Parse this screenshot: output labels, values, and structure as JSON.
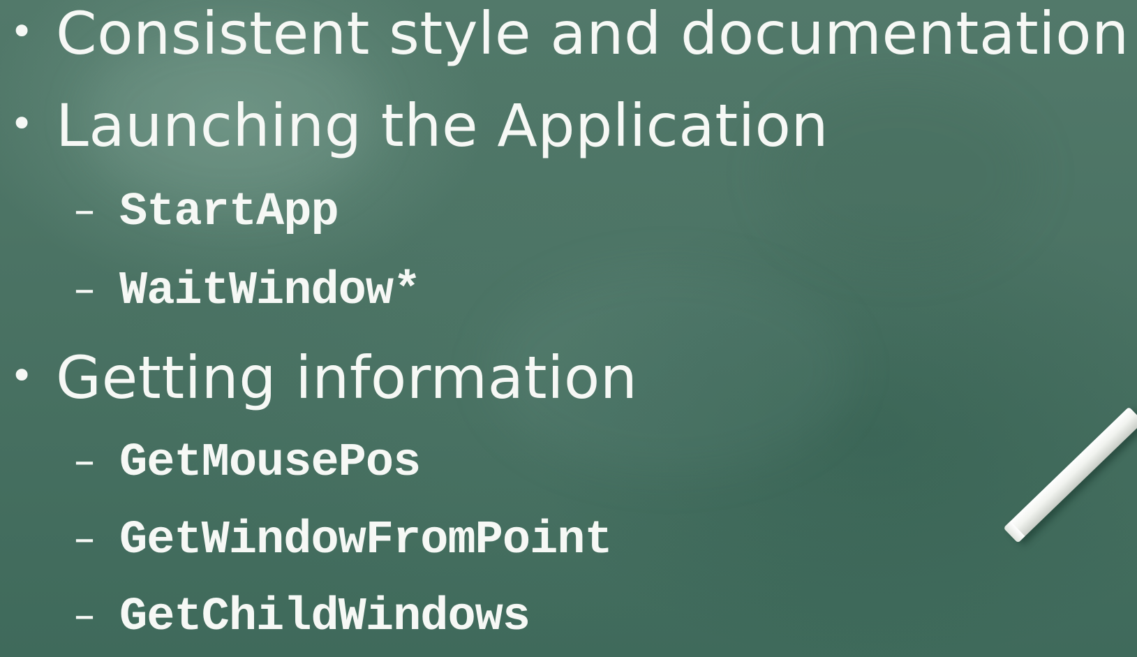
{
  "slide": {
    "bullet_glyph": "•",
    "dash_glyph": "–",
    "items": [
      {
        "level": 1,
        "text": "Consistent style and documentation"
      },
      {
        "level": 1,
        "text": "Launching the Application"
      },
      {
        "level": 2,
        "text": "StartApp"
      },
      {
        "level": 2,
        "text": "WaitWindow*"
      },
      {
        "level": 1,
        "text": "Getting information"
      },
      {
        "level": 2,
        "text": "GetMousePos"
      },
      {
        "level": 2,
        "text": "GetWindowFromPoint"
      },
      {
        "level": 2,
        "text": "GetChildWindows"
      }
    ]
  },
  "colors": {
    "board": "#476f60",
    "text": "#f6f8f5",
    "chalk": "#ffffff"
  }
}
